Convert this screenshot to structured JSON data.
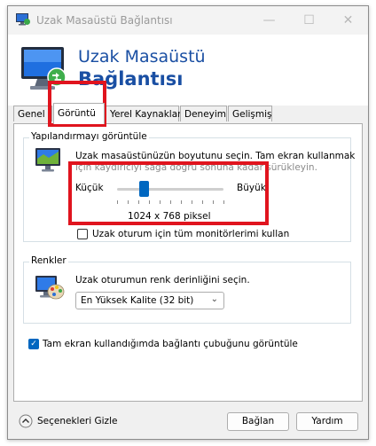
{
  "window": {
    "title": "Uzak Masaüstü Bağlantısı",
    "controls": {
      "minimize": "—",
      "maximize": "☐",
      "close": "✕"
    }
  },
  "header": {
    "line1": "Uzak Masaüstü",
    "line2": "Bağlantısı"
  },
  "tabs": [
    {
      "label": "Genel",
      "active": false
    },
    {
      "label": "Görüntü",
      "active": true
    },
    {
      "label": "Yerel Kaynaklar",
      "active": false
    },
    {
      "label": "Deneyim",
      "active": false
    },
    {
      "label": "Gelişmiş",
      "active": false
    }
  ],
  "display_config": {
    "group_label": "Yapılandırmayı görüntüle",
    "description_line1": "Uzak masaüstünüzün boyutunu seçin. Tam ekran kullanmak",
    "description_line2": "için kaydırıcıyı sağa doğru sonuna kadar sürükleyin.",
    "slider_min_label": "Küçük",
    "slider_max_label": "Büyük",
    "slider_position": 0.25,
    "resolution_text": "1024 x 768 piksel",
    "all_monitors_label": "Uzak oturum için tüm monitörlerimi kullan",
    "all_monitors_checked": false
  },
  "colors_group": {
    "group_label": "Renkler",
    "description": "Uzak oturumun renk derinliğini seçin.",
    "selected_depth": "En Yüksek Kalite (32 bit)"
  },
  "connection_bar": {
    "label": "Tam ekran kullandığımda bağlantı çubuğunu görüntüle",
    "checked": true,
    "check_glyph": "✓"
  },
  "footer": {
    "hide_options_label": "Seçenekleri Gizle",
    "connect_label": "Bağlan",
    "help_label": "Yardım"
  },
  "colors": {
    "accent": "#0067c0",
    "title_blue": "#1a4fa3",
    "highlight_red": "#e0141e"
  },
  "icons": {
    "app": "remote-desktop-icon",
    "header": "remote-desktop-monitor-icon",
    "display": "display-monitor-icon",
    "colors": "color-palette-monitor-icon",
    "hide_options": "chevron-up-circle-icon",
    "select_arrow": "chevron-down-icon"
  }
}
